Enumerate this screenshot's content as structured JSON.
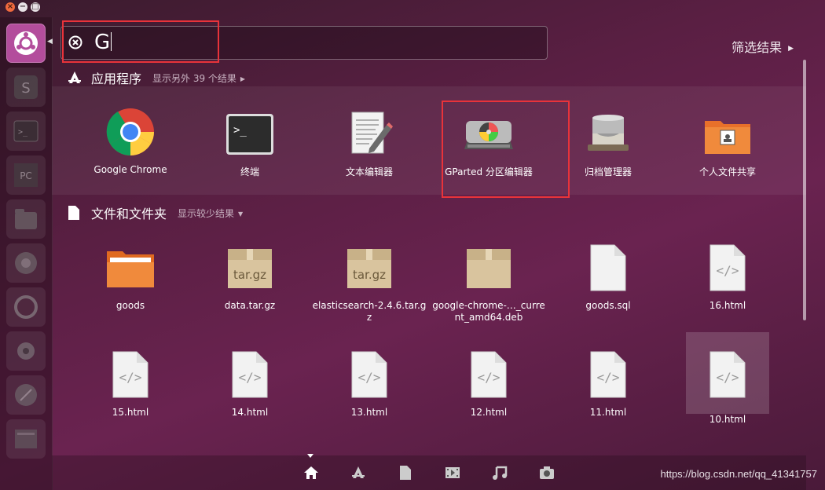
{
  "search": {
    "query": "G",
    "filter_label": "筛选结果"
  },
  "sections": {
    "apps": {
      "title": "应用程序",
      "more": "显示另外 39 个结果",
      "items": [
        {
          "label": "Google Chrome",
          "icon": "chrome-icon"
        },
        {
          "label": "终端",
          "icon": "terminal-icon"
        },
        {
          "label": "文本编辑器",
          "icon": "text-editor-icon"
        },
        {
          "label": "GParted 分区编辑器",
          "icon": "gparted-icon"
        },
        {
          "label": "归档管理器",
          "icon": "archive-manager-icon"
        },
        {
          "label": "个人文件共享",
          "icon": "file-sharing-icon"
        }
      ]
    },
    "files": {
      "title": "文件和文件夹",
      "more": "显示较少结果",
      "items": [
        {
          "label": "goods",
          "icon": "folder-icon"
        },
        {
          "label": "data.tar.gz",
          "icon": "archive-icon",
          "badge": "tar.gz"
        },
        {
          "label": "elasticsearch-2.4.6.tar.gz",
          "icon": "archive-icon",
          "badge": "tar.gz"
        },
        {
          "label": "google-chrome-…_current_amd64.deb",
          "icon": "package-icon"
        },
        {
          "label": "goods.sql",
          "icon": "document-icon"
        },
        {
          "label": "16.html",
          "icon": "html-file-icon"
        },
        {
          "label": "15.html",
          "icon": "html-file-icon"
        },
        {
          "label": "14.html",
          "icon": "html-file-icon"
        },
        {
          "label": "13.html",
          "icon": "html-file-icon"
        },
        {
          "label": "12.html",
          "icon": "html-file-icon"
        },
        {
          "label": "11.html",
          "icon": "html-file-icon"
        },
        {
          "label": "10.html",
          "icon": "html-file-icon"
        }
      ]
    }
  },
  "launcher": [
    "ubuntu-dash-icon",
    "sublime-icon",
    "terminal-icon",
    "pycharm-icon",
    "files-icon",
    "chrome-icon",
    "update-icon",
    "settings-icon",
    "browser-icon",
    "workspace-icon"
  ],
  "lenses": [
    "home-lens-icon",
    "apps-lens-icon",
    "files-lens-icon",
    "video-lens-icon",
    "music-lens-icon",
    "photo-lens-icon"
  ],
  "watermark": "https://blog.csdn.net/qq_41341757",
  "colors": {
    "accent": "#b34d9c",
    "highlight": "#e8333a"
  }
}
